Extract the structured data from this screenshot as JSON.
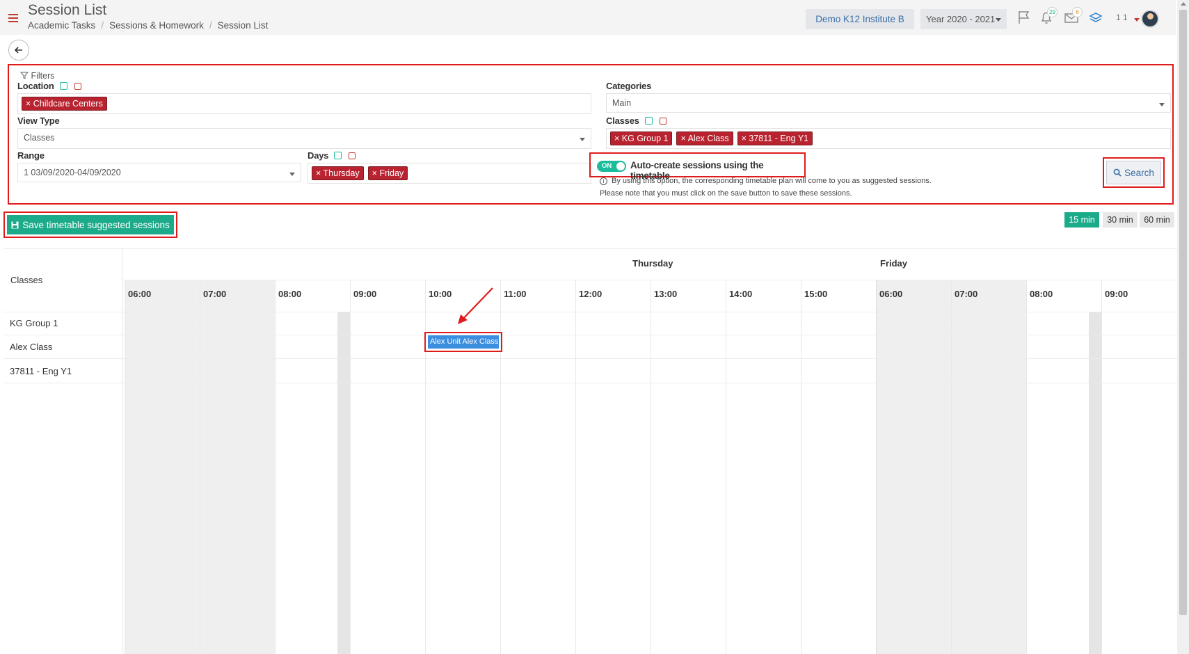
{
  "header": {
    "title": "Session List",
    "breadcrumb": [
      "Academic Tasks",
      "Sessions & Homework",
      "Session List"
    ],
    "institute": "Demo K12 Institute B",
    "year": "Year 2020 - 2021",
    "notifications_count": "29",
    "messages_count": "6",
    "user_num": "1 1"
  },
  "filters": {
    "title": "Filters",
    "location": {
      "label": "Location",
      "tags": [
        "Childcare Centers"
      ]
    },
    "categories": {
      "label": "Categories",
      "value": "Main"
    },
    "view_type": {
      "label": "View Type",
      "value": "Classes"
    },
    "classes": {
      "label": "Classes",
      "tags": [
        "KG Group 1",
        "Alex Class",
        "37811 - Eng Y1"
      ]
    },
    "range": {
      "label": "Range",
      "value": "1 03/09/2020-04/09/2020"
    },
    "days": {
      "label": "Days",
      "tags": [
        "Thursday",
        "Friday"
      ]
    },
    "auto_create": {
      "toggle_text": "ON",
      "label": "Auto-create sessions using the timetable",
      "note1": "By using this option, the corresponding timetable plan will come to you as suggested sessions.",
      "note2": "Please note that you must click on the save button to save these sessions."
    },
    "search_label": "Search"
  },
  "actions": {
    "save_label": "Save timetable suggested sessions",
    "intervals": [
      "15 min",
      "30 min",
      "60 min"
    ],
    "active_interval": "15 min"
  },
  "timeline": {
    "row_header": "Classes",
    "rows": [
      "KG Group 1",
      "Alex Class",
      "37811 - Eng Y1"
    ],
    "days": [
      {
        "name": "Thursday",
        "hours": [
          "06:00",
          "07:00",
          "08:00",
          "09:00",
          "10:00",
          "11:00",
          "12:00",
          "13:00",
          "14:00",
          "15:00"
        ]
      },
      {
        "name": "Friday",
        "hours": [
          "06:00",
          "07:00",
          "08:00",
          "09:00"
        ]
      }
    ],
    "event": {
      "label": "Alex Unit Alex Class (",
      "row": "Alex Class",
      "start": "10:00"
    }
  },
  "colors": {
    "accent": "#1cab8a",
    "tag": "#b8232f",
    "event": "#3b8ee0",
    "highlight": "#e01b1b"
  }
}
